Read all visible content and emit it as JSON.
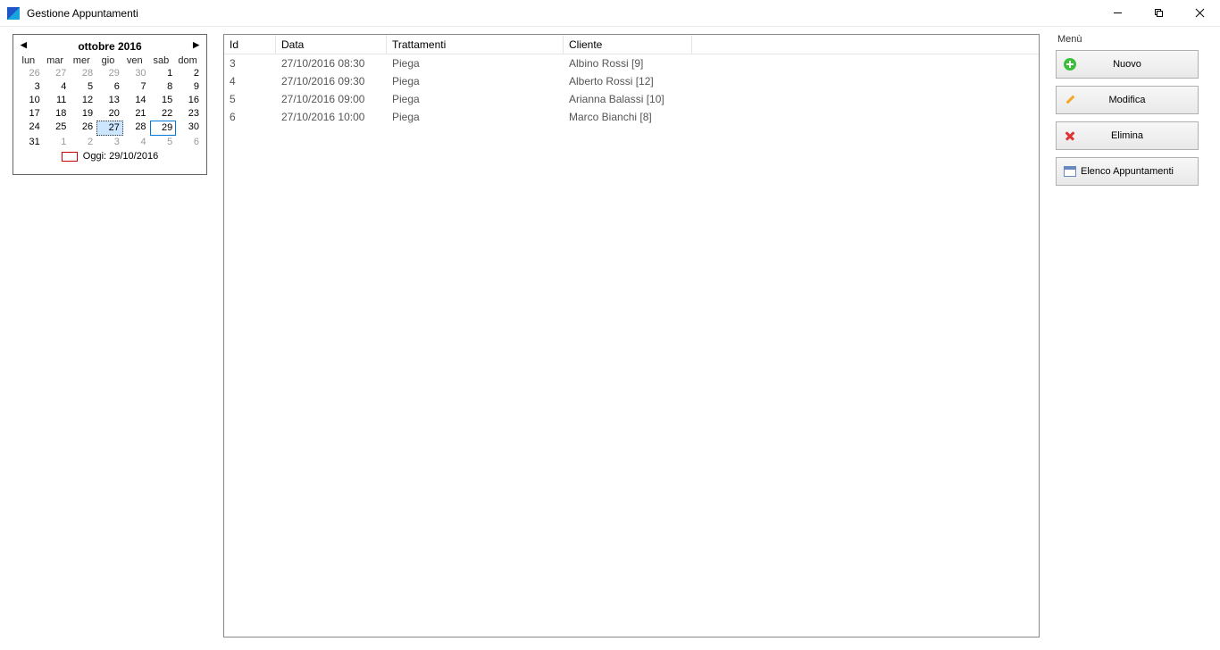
{
  "window": {
    "title": "Gestione Appuntamenti"
  },
  "calendar": {
    "title": "ottobre 2016",
    "dow": [
      "lun",
      "mar",
      "mer",
      "gio",
      "ven",
      "sab",
      "dom"
    ],
    "days": [
      {
        "n": "26",
        "out": true
      },
      {
        "n": "27",
        "out": true
      },
      {
        "n": "28",
        "out": true
      },
      {
        "n": "29",
        "out": true
      },
      {
        "n": "30",
        "out": true
      },
      {
        "n": "1"
      },
      {
        "n": "2"
      },
      {
        "n": "3"
      },
      {
        "n": "4"
      },
      {
        "n": "5"
      },
      {
        "n": "6"
      },
      {
        "n": "7"
      },
      {
        "n": "8"
      },
      {
        "n": "9"
      },
      {
        "n": "10"
      },
      {
        "n": "11"
      },
      {
        "n": "12"
      },
      {
        "n": "13"
      },
      {
        "n": "14"
      },
      {
        "n": "15"
      },
      {
        "n": "16"
      },
      {
        "n": "17"
      },
      {
        "n": "18"
      },
      {
        "n": "19"
      },
      {
        "n": "20"
      },
      {
        "n": "21"
      },
      {
        "n": "22"
      },
      {
        "n": "23"
      },
      {
        "n": "24"
      },
      {
        "n": "25"
      },
      {
        "n": "26"
      },
      {
        "n": "27",
        "selected": true
      },
      {
        "n": "28"
      },
      {
        "n": "29",
        "today": true
      },
      {
        "n": "30"
      },
      {
        "n": "31"
      },
      {
        "n": "1",
        "out": true
      },
      {
        "n": "2",
        "out": true
      },
      {
        "n": "3",
        "out": true
      },
      {
        "n": "4",
        "out": true
      },
      {
        "n": "5",
        "out": true
      },
      {
        "n": "6",
        "out": true
      }
    ],
    "footer": "Oggi: 29/10/2016"
  },
  "grid": {
    "headers": {
      "id": "Id",
      "data": "Data",
      "trat": "Trattamenti",
      "cli": "Cliente"
    },
    "rows": [
      {
        "id": "3",
        "data": "27/10/2016 08:30",
        "trat": "Piega",
        "cli": "Albino Rossi [9]"
      },
      {
        "id": "4",
        "data": "27/10/2016 09:30",
        "trat": "Piega",
        "cli": "Alberto Rossi [12]"
      },
      {
        "id": "5",
        "data": "27/10/2016 09:00",
        "trat": "Piega",
        "cli": "Arianna Balassi [10]"
      },
      {
        "id": "6",
        "data": "27/10/2016 10:00",
        "trat": "Piega",
        "cli": "Marco Bianchi [8]"
      }
    ]
  },
  "menu": {
    "label": "Menù",
    "nuovo": "Nuovo",
    "modifica": "Modifica",
    "elimina": "Elimina",
    "elenco": "Elenco Appuntamenti"
  }
}
